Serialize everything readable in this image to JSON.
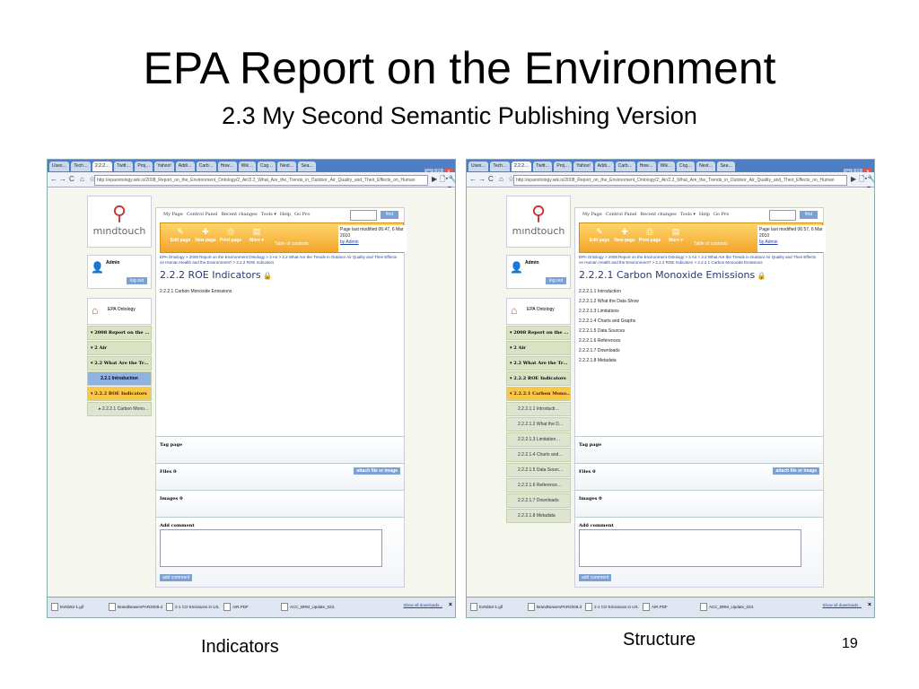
{
  "slide": {
    "title": "EPA Report on the Environment",
    "subtitle": "2.3 My Second Semantic Publishing Version",
    "caption_left": "Indicators",
    "caption_right": "Structure",
    "page_number": "19"
  },
  "browser": {
    "tabs": [
      "Uses…",
      "Tech…",
      "2.2.2…",
      "Twitt…",
      "Proj…",
      "Yahoo!",
      "Addi…",
      "Carb…",
      "How…",
      "Wik…",
      "Cog…",
      "Next…",
      "Sea…"
    ],
    "window_buttons": [
      "–",
      "□",
      "×"
    ],
    "nav_icons": [
      "←",
      "→",
      "C",
      "⌂",
      "☆"
    ],
    "menu_icons": [
      "▶",
      "🗋▾",
      "🔧▾"
    ]
  },
  "left_shot": {
    "url": "http://epaontology.wik.is/2008_Report_on_the_Environment_Ontology/2_Air/2.2_What_Are_the_Trends_in_Outdoor_Air_Quality_and_Their_Effects_on_Human",
    "active_tab": "2.2.2…",
    "page_title": "2.2.2 ROE Indicators",
    "breadcrumb": "EPA Ontology > 2008 Report on the Environment Ontology > 2 Air > 2.2 What Are the Trends in Outdoor Air Quality and Their Effects on Human Health and the Environment? > 2.2.2 ROE Indicators",
    "modified_line1": "Page last modified 06:47, 6 Mar 2010",
    "modified_by": "by Admin",
    "content": [
      "2.2.2.1 Carbon Monoxide Emissions"
    ],
    "tree": [
      {
        "label": "▾ 2008 Report on the …",
        "kind": "item"
      },
      {
        "label": "▾ 2 Air",
        "kind": "item"
      },
      {
        "label": "▾ 2.2 What Are the Tr…",
        "kind": "item"
      },
      {
        "label": "2.2.1 Introduction",
        "kind": "blue"
      },
      {
        "label": "▾ 2.2.2 ROE Indicators",
        "kind": "active"
      },
      {
        "label": "▸ 2.2.2.1 Carbon Mono…",
        "kind": "sub"
      }
    ]
  },
  "right_shot": {
    "url": "http://epaontology.wik.is/2008_Report_on_the_Environment_Ontology/2_Air/2.2_What_Are_the_Trends_in_Outdoor_Air_Quality_and_Their_Effects_on_Human",
    "active_tab": "2.2.2…",
    "page_title": "2.2.2.1 Carbon Monoxide Emissions",
    "breadcrumb": "EPA Ontology > 2008 Report on the Environment Ontology > 2 Air > 2.2 What Are the Trends in Outdoor Air Quality and Their Effects on Human Health and the Environment? > 2.2.2 ROE Indicators > 2.2.2.1 Carbon Monoxide Emissions",
    "modified_line1": "Page last modified 06:57, 6 Mar 2010",
    "modified_by": "by Admin",
    "content": [
      "2.2.2.1.1 Introduction",
      "2.2.2.1.2 What the Data Show",
      "2.2.2.1.3 Limitations",
      "2.2.2.1.4 Charts and Graphs",
      "2.2.2.1.5 Data Sources",
      "2.2.2.1.6 References",
      "2.2.2.1.7 Downloads",
      "2.2.2.1.8 Metadata"
    ],
    "tree": [
      {
        "label": "▾ 2008 Report on the …",
        "kind": "item"
      },
      {
        "label": "▾ 2 Air",
        "kind": "item"
      },
      {
        "label": "▾ 2.2 What Are the Tr…",
        "kind": "item"
      },
      {
        "label": "▾ 2.2.2 ROE Indicators",
        "kind": "item"
      },
      {
        "label": "▾ 2.2.2.1 Carbon Mono…",
        "kind": "active"
      },
      {
        "label": "2.2.2.1.1 Introducti…",
        "kind": "sub"
      },
      {
        "label": "2.2.2.1.2 What the D…",
        "kind": "sub"
      },
      {
        "label": "2.2.2.1.3 Limitation…",
        "kind": "sub"
      },
      {
        "label": "2.2.2.1.4 Charts and…",
        "kind": "sub"
      },
      {
        "label": "2.2.2.1.5 Data Sourc…",
        "kind": "sub"
      },
      {
        "label": "2.2.2.1.6 Reference…",
        "kind": "sub"
      },
      {
        "label": "2.2.2.1.7 Downloads",
        "kind": "sub"
      },
      {
        "label": "2.2.2.1.8 Metadata",
        "kind": "sub"
      }
    ]
  },
  "wiki": {
    "logo_text": "mındtouch",
    "user": "Admin",
    "logout": "log out",
    "ontology": "EPA Ontology",
    "top_menu": [
      "My Page",
      "Control Panel",
      "Recent changes",
      "Tools ▾",
      "Help",
      "Go Pro"
    ],
    "find": "find",
    "toolbar": [
      "Edit page",
      "New page",
      "Print page",
      "More ▾"
    ],
    "toc": "Table of contents",
    "tag_page": "Tag page",
    "files": "Files 0",
    "attach": "attach file or image",
    "images": "Images 0",
    "add_comment_heading": "Add comment",
    "add_comment_button": "add comment"
  },
  "downloads": {
    "items": [
      "EvNb62-1.gif",
      "BrandNewervPAR2009.doc",
      "2-1 CO Emissions in US.xls",
      "AIR.PDF",
      "ACC_BRM_Update_023....ppt"
    ],
    "show_all": "Show all downloads...",
    "close": "×"
  }
}
